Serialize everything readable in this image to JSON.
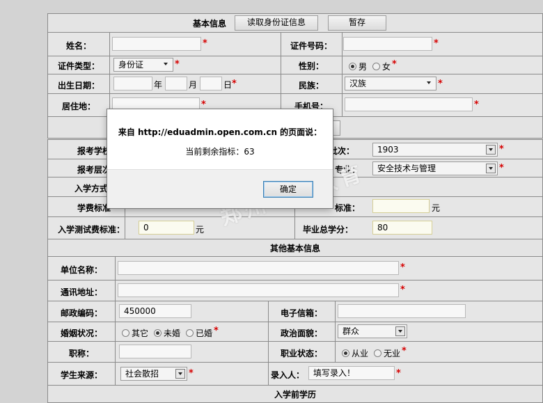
{
  "toolbar": {
    "section_title": "基本信息",
    "read_id_button": "读取身份证信息",
    "save_draft_button": "暂存"
  },
  "basic": {
    "name_label": "姓名：",
    "id_number_label": "证件号码：",
    "id_type_label": "证件类型：",
    "id_type_value": "身份证",
    "gender_label": "性别：",
    "gender_options": [
      "男",
      "女"
    ],
    "gender_selected": "男",
    "birth_label": "出生日期：",
    "birth_year_unit": "年",
    "birth_month_unit": "月",
    "birth_day_unit": "日",
    "ethnicity_label": "民族：",
    "ethnicity_value": "汉族",
    "residence_label": "居住地：",
    "phone_label": "手机号：",
    "required_mark": "*"
  },
  "enroll": {
    "school_label": "报考学校",
    "batch_label_partial": "批次：",
    "batch_value": "1903",
    "level_label": "报考层次",
    "major_label_partial": "专业：",
    "major_value": "安全技术与管理",
    "admission_label": "入学方式",
    "tuition_label": "学费标准",
    "fee_label_partial": "标准：",
    "fee_unit": "元",
    "test_fee_label": "入学测试费标准：",
    "test_fee_value": "0",
    "test_fee_unit": "元",
    "credits_label_partial": "毕业总学分：",
    "credits_value": "80"
  },
  "other": {
    "section_title": "其他基本信息",
    "employer_label": "单位名称：",
    "address_label": "通讯地址：",
    "postal_label": "邮政编码：",
    "postal_value": "450000",
    "email_label": "电子信箱：",
    "marital_label": "婚姻状况：",
    "marital_options": [
      "其它",
      "未婚",
      "已婚"
    ],
    "marital_selected": "未婚",
    "political_label": "政治面貌：",
    "political_value": "群众",
    "title_label": "职称：",
    "job_status_label": "职业状态：",
    "job_status_options": [
      "从业",
      "无业"
    ],
    "job_status_selected": "从业",
    "source_label": "学生来源：",
    "source_value": "社会散招",
    "recorder_label": "录入人：",
    "recorder_value": "填写录入！"
  },
  "prior": {
    "section_title": "入学前学历"
  },
  "dialog": {
    "title": "来自 http://eduadmin.open.com.cn 的页面说：",
    "message": "当前剩余指标：63",
    "ok_button": "确定"
  },
  "watermark": "郑州一帆教育"
}
